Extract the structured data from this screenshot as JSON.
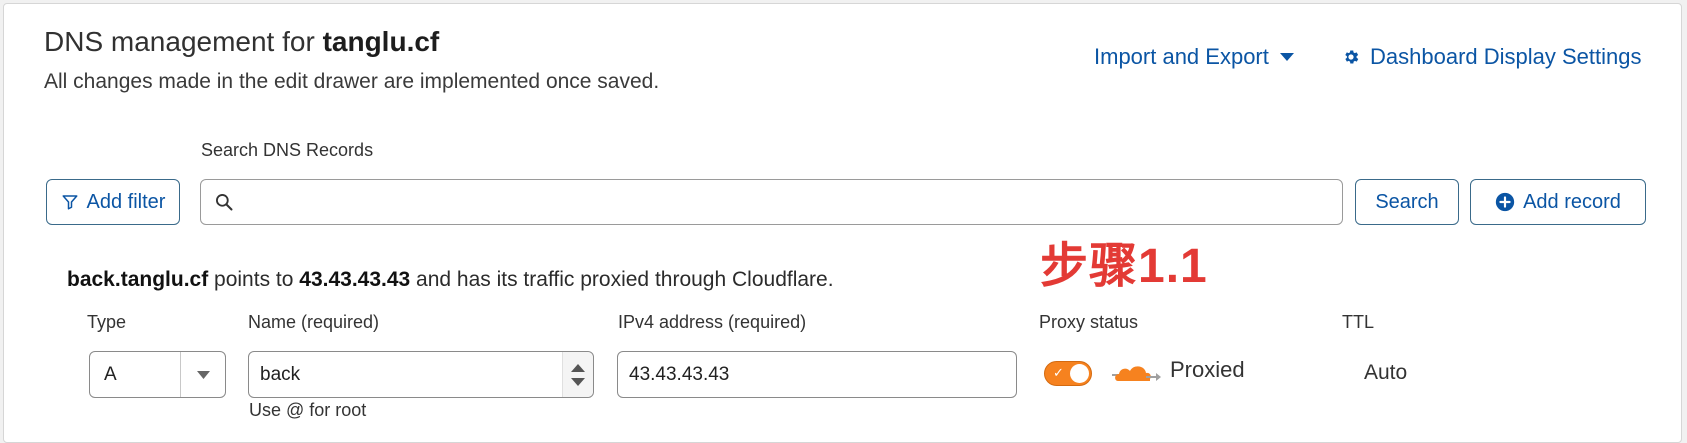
{
  "header": {
    "title_prefix": "DNS management for ",
    "title_domain": "tanglu.cf",
    "subtitle": "All changes made in the edit drawer are implemented once saved.",
    "import_export_label": "Import and Export",
    "settings_label": "Dashboard Display Settings"
  },
  "search": {
    "label": "Search DNS Records",
    "value": "",
    "placeholder": "",
    "add_filter_label": "Add filter",
    "search_button_label": "Search",
    "add_record_label": "Add record"
  },
  "annotation": "步骤1.1",
  "summary": {
    "record_name": "back.tanglu.cf",
    "text_points_to": " points to ",
    "address": "43.43.43.43",
    "text_rest": " and has its traffic proxied through Cloudflare."
  },
  "record_form": {
    "type_label": "Type",
    "type_value": "A",
    "name_label": "Name (required)",
    "name_value": "back",
    "name_hint": "Use @ for root",
    "ip_label": "IPv4 address (required)",
    "ip_value": "43.43.43.43",
    "proxy_label": "Proxy status",
    "proxy_on": true,
    "proxy_text": "Proxied",
    "ttl_label": "TTL",
    "ttl_value": "Auto"
  },
  "colors": {
    "link": "#0b55a4",
    "accent_orange": "#f6821f",
    "annotation_red": "#e33a35"
  },
  "icons": [
    "filter-icon",
    "search-icon",
    "plus-circle-icon",
    "gear-icon",
    "caret-down-icon",
    "cloud-icon",
    "check-icon",
    "spinner-arrows-icon"
  ]
}
